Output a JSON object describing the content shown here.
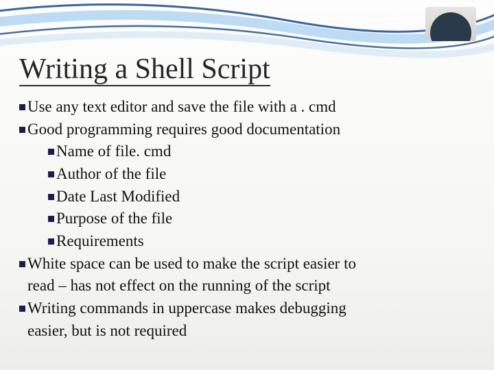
{
  "title": "Writing a Shell Script",
  "bullets": {
    "b1": "Use any text editor and save the file with a . cmd",
    "b2": "Good programming requires good documentation",
    "b2_1": "Name of file. cmd",
    "b2_2": "Author of the file",
    "b2_3": "Date Last Modified",
    "b2_4": "Purpose of the file",
    "b2_5": "Requirements",
    "b3_line1": "White space can be used to make the script easier to",
    "b3_line2": "read – has not effect on the running of the script",
    "b4_line1": "Writing commands in uppercase makes debugging",
    "b4_line2": "easier, but is not required"
  }
}
